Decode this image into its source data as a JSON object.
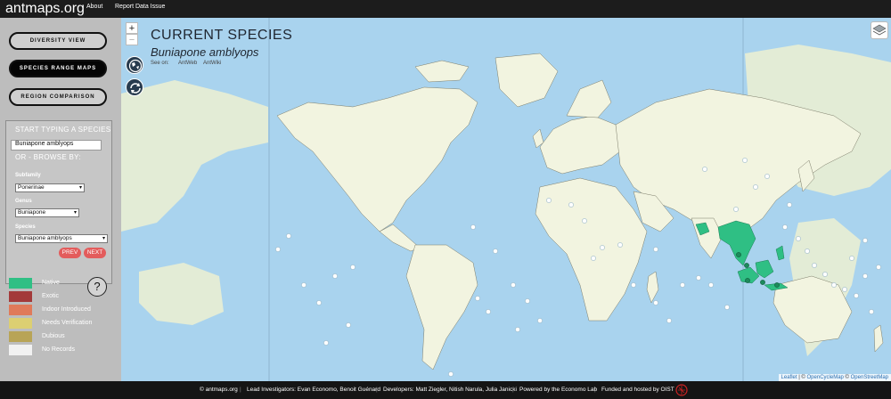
{
  "brand": "antmaps.org",
  "nav": {
    "about": "About",
    "report": "Report Data Issue"
  },
  "modes": {
    "diversity": "DIVERSITY VIEW",
    "species": "SPECIES RANGE MAPS",
    "region": "REGION COMPARISON"
  },
  "species_panel": {
    "heading": "START TYPING A SPECIES",
    "search_value": "Buniapone amblyops",
    "browse_heading": "OR - BROWSE BY:",
    "subfamily_label": "Subfamily",
    "subfamily_value": "Ponerinae",
    "genus_label": "Genus",
    "genus_value": "Buniapone",
    "species_label": "Species",
    "species_value": "Buniapone amblyops",
    "prev": "PREV",
    "next": "NEXT"
  },
  "legend": {
    "items": [
      {
        "label": "Native",
        "color": "#2fbf84"
      },
      {
        "label": "Exotic",
        "color": "#a33a3a"
      },
      {
        "label": "Indoor Introduced",
        "color": "#e07a5a"
      },
      {
        "label": "Needs Verification",
        "color": "#dccf72"
      },
      {
        "label": "Dubious",
        "color": "#b8a456"
      },
      {
        "label": "No Records",
        "color": "#f1f1f1"
      }
    ],
    "help": "?"
  },
  "map": {
    "title": "CURRENT SPECIES",
    "species": "Buniapone amblyops",
    "see_on": "See on:",
    "links": {
      "antweb": "AntWeb",
      "antwiki": "AntWiki"
    },
    "zoom_in": "+",
    "zoom_out": "−",
    "attribution": {
      "leaflet": "Leaflet",
      "sep": " | © ",
      "ocm": "OpenCycleMap",
      "osm": "OpenStreetMap"
    }
  },
  "footer": {
    "copyright": "© antmaps.org",
    "lead": "Lead Investigators: Evan Economo, Benoit Guénard",
    "devs": "Developers: Matt Ziegler, Nitish Narula, Julia Janicki",
    "powered": "Powered by the Economo Lab",
    "funded": "Funded and hosted by OIST"
  },
  "colors": {
    "topbar": "#1c1c1c",
    "sidebar": "#bdbdbd",
    "ocean": "#a9d3ee",
    "land": "#f2f4e0",
    "native": "#2fbf84"
  }
}
